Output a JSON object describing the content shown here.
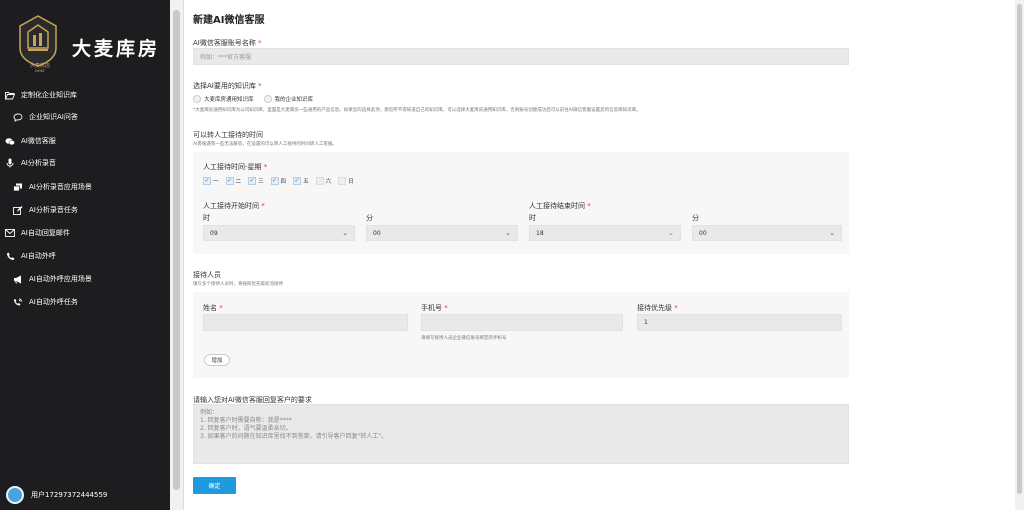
{
  "sidebar": {
    "logo_text": "大麦库房",
    "logo_badge_text": "大麦房店",
    "logo_badge_sub": "DMKF",
    "items": [
      {
        "label": "定制化企业知识库",
        "icon": "folder-open-icon",
        "level": 0
      },
      {
        "label": "企业知识AI问答",
        "icon": "chat-bubble-icon",
        "level": 1
      },
      {
        "label": "AI微信客服",
        "icon": "wechat-icon",
        "level": 0
      },
      {
        "label": "AI分析录音",
        "icon": "microphone-icon",
        "level": 0
      },
      {
        "label": "AI分析录音应用场景",
        "icon": "window-stack-icon",
        "level": 1
      },
      {
        "label": "AI分析录音任务",
        "icon": "edit-icon",
        "level": 1
      },
      {
        "label": "AI自动回复邮件",
        "icon": "envelope-icon",
        "level": 0
      },
      {
        "label": "AI自动外呼",
        "icon": "phone-icon",
        "level": 0
      },
      {
        "label": "AI自动外呼应用场景",
        "icon": "megaphone-icon",
        "level": 1
      },
      {
        "label": "AI自动外呼任务",
        "icon": "phone-ring-icon",
        "level": 1
      }
    ],
    "user": "用户17297372444559"
  },
  "page": {
    "title": "新建AI微信客服",
    "account_name": {
      "label": "AI微信客服账号名称",
      "placeholder": "例如：***官方客服"
    },
    "knowledge": {
      "label": "选择AI要用的知识库",
      "option1": "大麦库房通用知识库",
      "option2": "我的企业知识库",
      "hint": "*大麦库房通用知识库为公司知识库，里面是大麦库房一些通用的产品信息。如果您的选择此项，那您所不得知道自己的知识库，可以选择大麦库房通用知识库，否则账号创建成功后可以前往AI微信客服设置您的信息库知识库。"
    },
    "transfer": {
      "label": "可以转人工接待的时间",
      "hint": "AI客服遇到一些无法解答，在设置的可以转人工接待的时间转人工客服。"
    },
    "weekday": {
      "label": "人工接待时间-星期",
      "days": [
        "一",
        "二",
        "三",
        "四",
        "五",
        "六",
        "日"
      ],
      "checked": [
        true,
        true,
        true,
        true,
        true,
        false,
        false
      ]
    },
    "start_time": {
      "label": "人工接待开始时间",
      "hour_label": "时",
      "minute_label": "分",
      "hour": "09",
      "minute": "00"
    },
    "end_time": {
      "label": "人工接待结束时间",
      "hour_label": "时",
      "minute_label": "分",
      "hour": "18",
      "minute": "00"
    },
    "staff": {
      "label": "接待人员",
      "hint": "填写多个接待人员时，将按照优先级轮流接待",
      "name_label": "姓名",
      "phone_label": "手机号",
      "priority_label": "接待优先级",
      "priority_value": "1",
      "phone_hint": "请填写接待人员企业微信账号绑定的手机号",
      "add_button": "增加"
    },
    "requirement": {
      "label": "请输入您对AI微信客服回复客户的要求",
      "placeholder": "例如：\n1. 回复客户时需要自称：我是****\n2. 回复客户时，语气要温柔亲切。\n3. 如果客户的问题在知识库里找不到答案，请引导客户回复\"转人工\"。"
    },
    "submit": "确定"
  },
  "colors": {
    "sidebar_bg": "#1d1d1f",
    "primary": "#1e9be0",
    "required": "#e33333"
  }
}
